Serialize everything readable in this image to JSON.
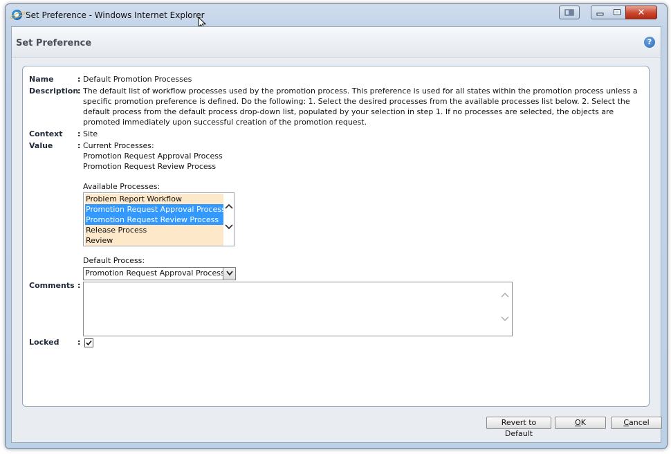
{
  "window": {
    "title": "Set Preference - Windows Internet Explorer",
    "minimize_glyph": "▭",
    "maximize_glyph": "□",
    "close_glyph": "✕"
  },
  "dialog": {
    "title": "Set Preference",
    "help_glyph": "?"
  },
  "fields": {
    "name_label": "Name",
    "name_value": "Default Promotion Processes",
    "description_label": "Description",
    "description_value": "The default list of workflow processes used by the promotion process. This preference is used for all states within the promotion process unless a specific promotion preference is defined. Do the following: 1. Select the desired processes from the available processes list below. 2. Select the default process from the default process drop-down list, populated by your selection in step 1. If no processes are selected, the objects are promoted immediately upon successful creation of the promotion request.",
    "context_label": "Context",
    "context_value": "Site",
    "value_label": "Value",
    "current_processes_label": "Current Processes:",
    "current_processes": [
      "Promotion Request Approval Process",
      "Promotion Request Review Process"
    ],
    "available_processes_label": "Available Processes:",
    "available_processes": [
      {
        "label": "Problem Report Workflow",
        "selected": false
      },
      {
        "label": "Promotion Request Approval Process",
        "selected": true
      },
      {
        "label": "Promotion Request Review Process",
        "selected": true
      },
      {
        "label": "Release Process",
        "selected": false
      },
      {
        "label": "Review",
        "selected": false
      }
    ],
    "default_process_label": "Default Process:",
    "default_process_value": "Promotion Request Approval Process",
    "comments_label": "Comments",
    "comments_value": "",
    "locked_label": "Locked",
    "locked_checked": true,
    "colon": ":"
  },
  "buttons": {
    "revert": "Revert to Default",
    "ok_prefix": "",
    "ok_accel": "O",
    "ok_rest": "K",
    "cancel_accel": "C",
    "cancel_rest": "ancel"
  },
  "colors": {
    "selection": "#3399ff",
    "list_bg": "#fde9c9",
    "frame": "#bcd0e6"
  }
}
